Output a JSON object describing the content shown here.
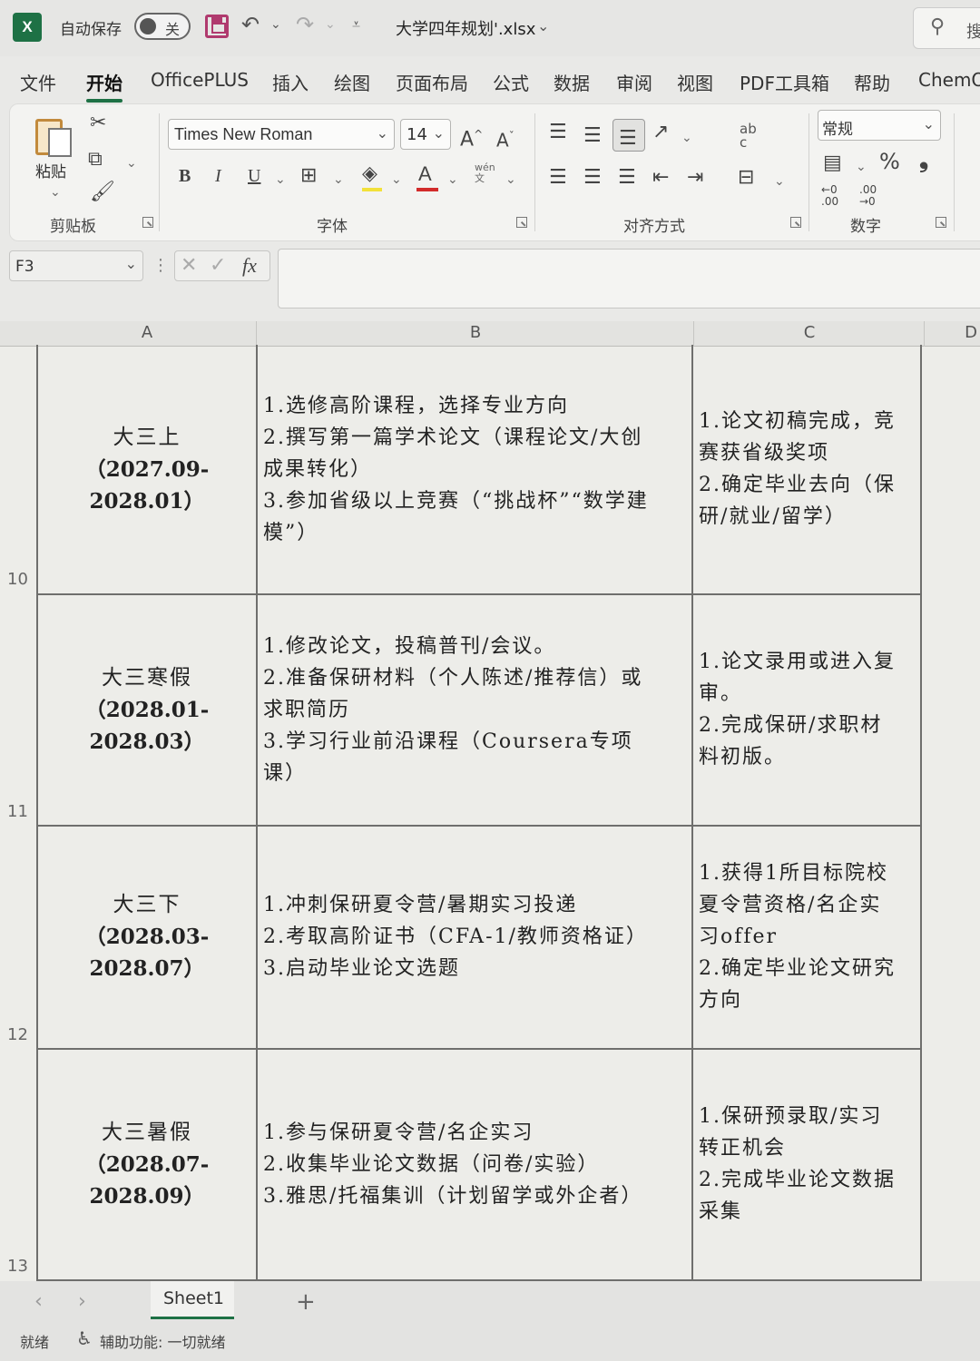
{
  "titlebar": {
    "autosave_label": "自动保存",
    "autosave_state": "关",
    "filename": "大学四年规划'.xlsx",
    "search_text": "搜"
  },
  "menu_tabs": [
    "文件",
    "开始",
    "OfficePLUS",
    "插入",
    "绘图",
    "页面布局",
    "公式",
    "数据",
    "审阅",
    "视图",
    "PDF工具箱",
    "帮助",
    "ChemO"
  ],
  "active_tab": "开始",
  "ribbon": {
    "paste_label": "粘贴",
    "group_clipboard": "剪贴板",
    "font_name": "Times New Roman",
    "font_size": "14",
    "group_font": "字体",
    "group_alignment": "对齐方式",
    "number_format": "常规",
    "group_number": "数字",
    "increase_font": "A",
    "decrease_font": "A",
    "bold": "B",
    "italic": "I",
    "underline": "U",
    "font_color": "A",
    "phonetic_top": "wén",
    "phonetic_bottom": "文",
    "wrap_top": "ab",
    "wrap_bottom": "c",
    "percent": "%",
    "comma": "❟",
    "inc_decimal_top": "←0",
    "inc_decimal_bottom": ".00",
    "dec_decimal_top": ".00",
    "dec_decimal_bottom": "→0"
  },
  "formula_bar": {
    "cell_ref": "F3",
    "fx": "fx",
    "value": ""
  },
  "columns": [
    "A",
    "B",
    "C",
    "D"
  ],
  "rows": [
    {
      "row": "10",
      "a": [
        "大三上",
        "（2027.09-",
        "2028.01）"
      ],
      "b": [
        "1.选修高阶课程，选择专业方向",
        "2.撰写第一篇学术论文（课程论文/大创",
        "成果转化）",
        "3.参加省级以上竞赛（“挑战杯”“数学建",
        "模”）"
      ],
      "c": [
        "1.论文初稿完成，竞",
        "赛获省级奖项",
        "2.确定毕业去向（保",
        "研/就业/留学）"
      ]
    },
    {
      "row": "11",
      "a": [
        "大三寒假",
        "（2028.01-",
        "2028.03）"
      ],
      "b": [
        "1.修改论文，投稿普刊/会议。",
        "2.准备保研材料（个人陈述/推荐信）或",
        "求职简历",
        "3.学习行业前沿课程（Coursera专项",
        "课）"
      ],
      "c": [
        "1.论文录用或进入复",
        "审。",
        "2.完成保研/求职材",
        "料初版。"
      ]
    },
    {
      "row": "12",
      "a": [
        "大三下",
        "（2028.03-",
        "2028.07）"
      ],
      "b": [
        "1.冲刺保研夏令营/暑期实习投递",
        "2.考取高阶证书（CFA-1/教师资格证）",
        "3.启动毕业论文选题"
      ],
      "c": [
        "1.获得1所目标院校",
        "夏令营资格/名企实",
        "习offer",
        "2.确定毕业论文研究",
        "方向"
      ]
    },
    {
      "row": "13",
      "a": [
        "大三暑假",
        "（2028.07-",
        "2028.09）"
      ],
      "b": [
        "1.参与保研夏令营/名企实习",
        "2.收集毕业论文数据（问卷/实验）",
        "3.雅思/托福集训（计划留学或外企者）"
      ],
      "c": [
        "1.保研预录取/实习",
        "转正机会",
        "2.完成毕业论文数据",
        "采集"
      ]
    }
  ],
  "sheet_tab": "Sheet1",
  "status": {
    "ready": "就绪",
    "accessibility": "辅助功能: 一切就绪"
  }
}
